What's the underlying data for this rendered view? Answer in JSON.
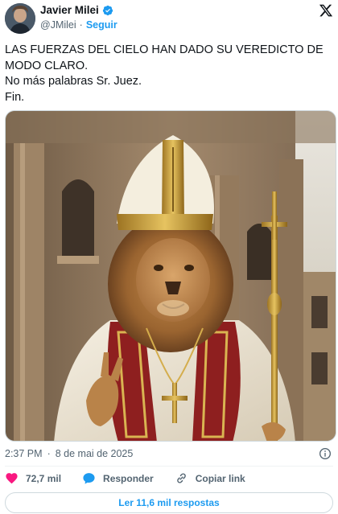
{
  "author": {
    "display_name": "Javier Milei",
    "handle": "@JMilei",
    "separator": "·",
    "follow_label": "Seguir",
    "verified_color": "#1d9bf0"
  },
  "tweet": {
    "lines": [
      "LAS FUERZAS DEL CIELO HAN DADO SU VEREDICTO DE MODO CLARO.",
      "No más palabras Sr. Juez.",
      "Fin."
    ]
  },
  "meta": {
    "time": "2:37 PM",
    "separator": "·",
    "date": "8 de mai de 2025"
  },
  "actions": {
    "likes": "72,7 mil",
    "reply_label": "Responder",
    "copy_link_label": "Copiar link"
  },
  "replies_button": {
    "label": "Ler 11,6 mil respostas"
  },
  "colors": {
    "accent": "#1d9bf0",
    "like": "#f91880",
    "text": "#0f1419",
    "muted": "#536471"
  }
}
